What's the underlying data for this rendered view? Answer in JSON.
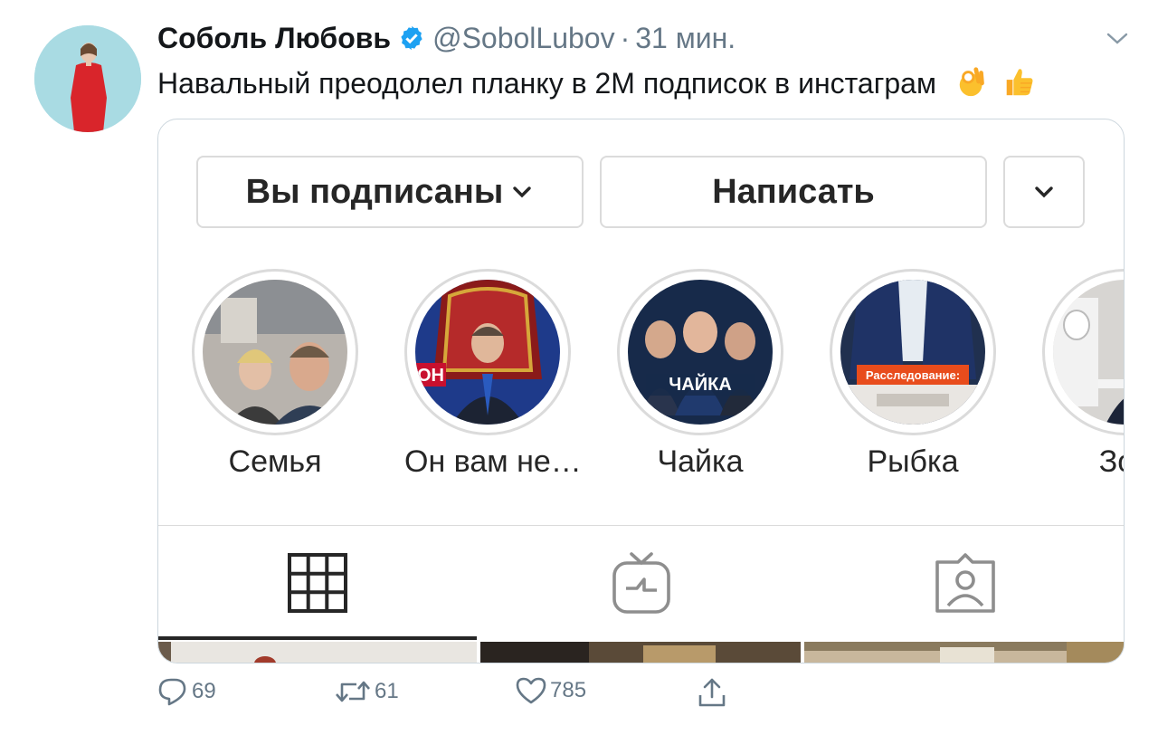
{
  "tweet": {
    "author_name": "Соболь Любовь",
    "handle": "@SobolLubov",
    "separator": "·",
    "time": "31 мин.",
    "text": "Навальный преодолел планку в 2М подписок в инстаграм",
    "emojis": [
      "ok-hand-emoji",
      "thumbs-up-emoji"
    ]
  },
  "instagram": {
    "follow_button": "Вы подписаны",
    "message_button": "Написать",
    "highlights": [
      {
        "label": "Семья"
      },
      {
        "label": "Он вам не…"
      },
      {
        "label": "Чайка"
      },
      {
        "label": "Рыбка"
      },
      {
        "label": "Зол"
      }
    ],
    "tabs": [
      "grid-icon",
      "igtv-icon",
      "tagged-icon"
    ],
    "active_tab": "grid-icon"
  },
  "actions": {
    "replies": "69",
    "retweets": "61",
    "likes": "785"
  },
  "colors": {
    "text_primary": "#14171a",
    "text_secondary": "#657786",
    "verified": "#1da1f2",
    "card_border": "#ccd6dd",
    "ig_border": "#dbdbdb"
  }
}
